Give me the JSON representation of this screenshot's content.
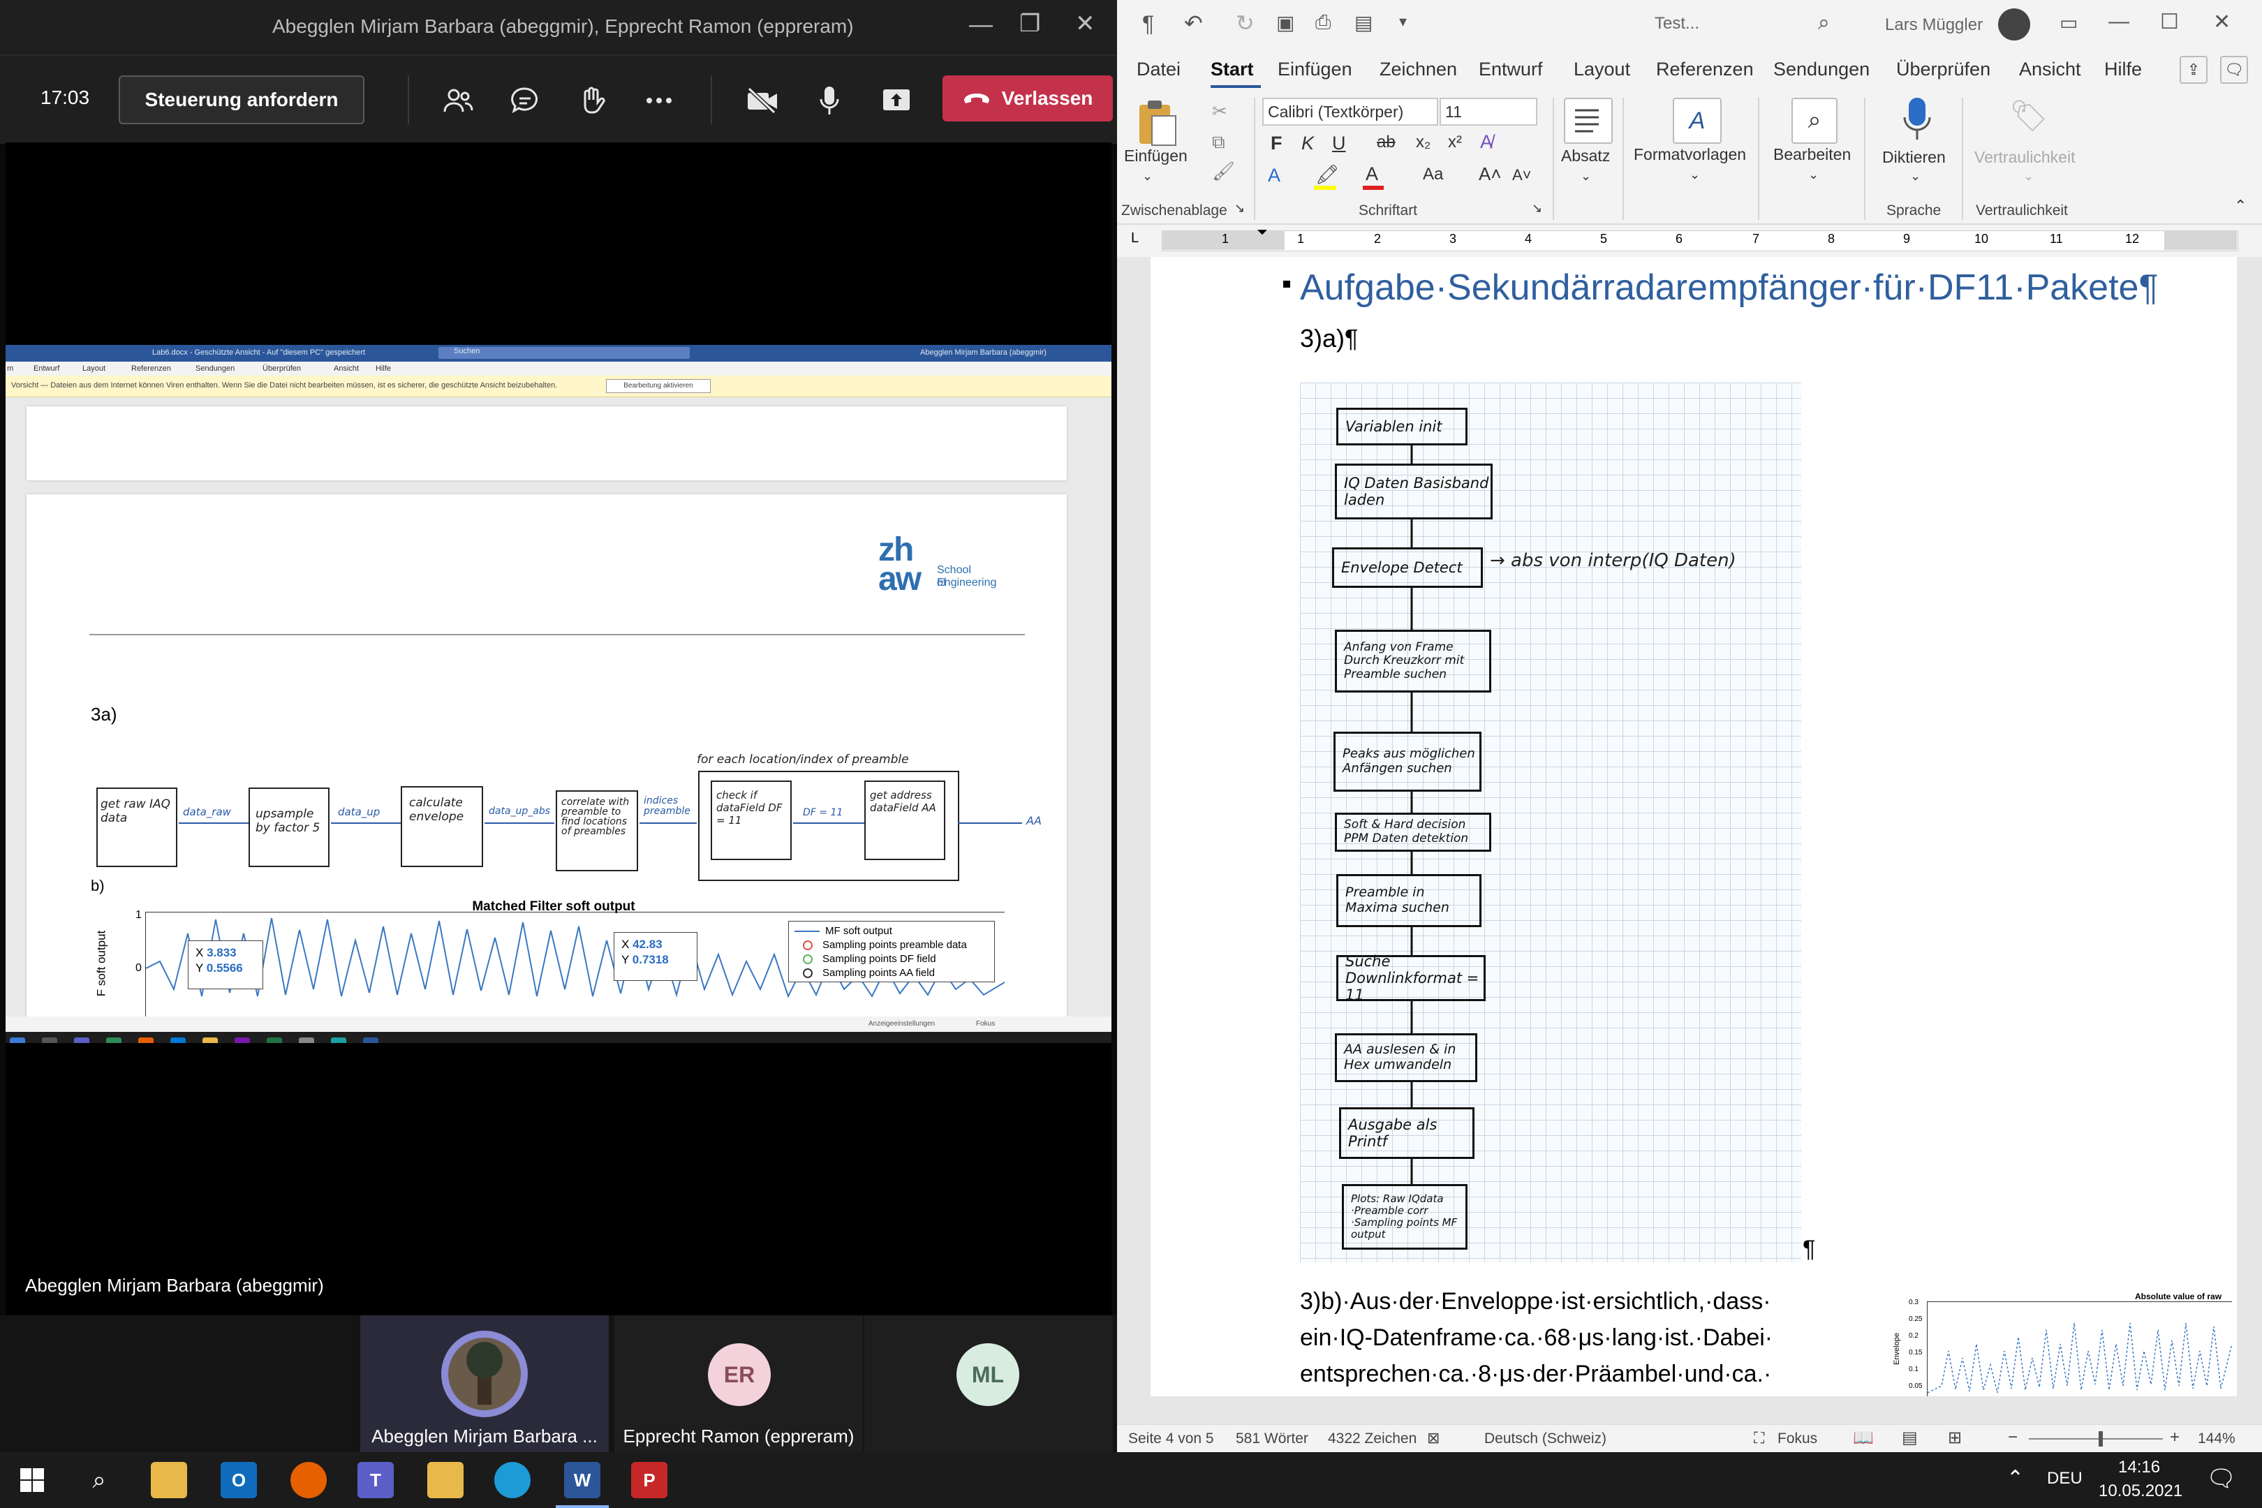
{
  "teams": {
    "window_title": "Abegglen Mirjam Barbara (abeggmir), Epprecht Ramon (eppreram)",
    "call_time": "17:03",
    "request_control": "Steuerung anfordern",
    "leave": "Verlassen",
    "shared_screen": {
      "title": "Lab6.docx - Geschützte Ansicht - Auf \"diesem PC\" gespeichert",
      "search": "Suchen",
      "user": "Abegglen Mirjam Barbara (abeggmir)",
      "tabs": [
        "m",
        "Entwurf",
        "Layout",
        "Referenzen",
        "Sendungen",
        "Überprüfen",
        "Ansicht",
        "Hilfe"
      ],
      "protected_msg": "Vorsicht — Dateien aus dem Internet können Viren enthalten. Wenn Sie die Datei nicht bearbeiten müssen, ist es sicherer, die geschützte Ansicht beizubehalten.",
      "enable_editing": "Bearbeitung aktivieren",
      "logo_zh": "zh",
      "logo_aw": "aw",
      "logo_school": "School of",
      "logo_engineering": "Engineering",
      "section_a": "3a)",
      "section_b": "b)",
      "loop_label": "for each location/index of preamble",
      "blocks": [
        "get raw IAQ data",
        "upsample by factor 5",
        "calculate envelope",
        "correlate with preamble to find locations of preambles",
        "check if dataField DF = 11",
        "get address dataField AA"
      ],
      "arrows": [
        "data_raw",
        "data_up",
        "data_up_abs",
        "indices preamble",
        "DF = 11",
        "AA"
      ],
      "chart": {
        "title": "Matched Filter soft output",
        "ylabel": "F soft output",
        "y_ticks": [
          "1",
          "0"
        ],
        "legend": [
          "MF soft output",
          "Sampling points preamble data",
          "Sampling points DF field",
          "Sampling points AA field"
        ],
        "tip1": {
          "x": "3.833",
          "y": "0.5566"
        },
        "tip2": {
          "x": "42.83",
          "y": "0.7318"
        }
      },
      "status_items": [
        "Anzeigeeinstellungen",
        "Fokus"
      ]
    },
    "presenter_label": "Abegglen Mirjam Barbara (abeggmir)",
    "participants": [
      {
        "name": "Abegglen Mirjam Barbara ...",
        "initials": ""
      },
      {
        "name": "Epprecht Ramon (eppreram)",
        "initials": "ER"
      },
      {
        "name": "",
        "initials": "ML"
      }
    ]
  },
  "word": {
    "title": "Test...",
    "user": "Lars Müggler",
    "tabs": [
      "Datei",
      "Start",
      "Einfügen",
      "Zeichnen",
      "Entwurf",
      "Layout",
      "Referenzen",
      "Sendungen",
      "Überprüfen",
      "Ansicht",
      "Hilfe"
    ],
    "active_tab": "Start",
    "ribbon": {
      "paste": "Einfügen",
      "font": "Calibri (Textkörper)",
      "size": "11",
      "paragraph": "Absatz",
      "styles": "Formatvorlagen",
      "edit": "Bearbeiten",
      "dictate": "Diktieren",
      "sensitivity": "Vertraulichkeit",
      "groups": [
        "Zwischenablage",
        "Schriftart",
        "Sprache",
        "Vertraulichkeit"
      ],
      "bold": "F",
      "italic": "K",
      "underline": "U",
      "strike": "ab",
      "sub": "x₂",
      "sup": "x²",
      "case": "Aa"
    },
    "ruler": [
      "1",
      "1",
      "2",
      "3",
      "4",
      "5",
      "6",
      "7",
      "8",
      "9",
      "10",
      "11",
      "12"
    ],
    "heading": "Aufgabe·Sekundärradarempfänger·für·DF11·Pakete¶",
    "sub_heading": "3)a)¶",
    "flowchart": [
      "Variablen init",
      "IQ Daten Basisband laden",
      "Envelope Detect",
      "Anfang von Frame Durch Kreuzkorr mit Preamble suchen",
      "Peaks aus möglichen Anfängen suchen",
      "Soft & Hard decision PPM Daten detektion",
      "Preamble in Maxima suchen",
      "Suche Downlinkformat = 11",
      "AA auslesen & in Hex umwandeln",
      "Ausgabe als Printf",
      "Plots: Raw IQdata ·Preamble corr ·Sampling points MF output"
    ],
    "flow_annotation": "→ abs von interp(IQ Daten)",
    "pilcrow": "¶",
    "para_lines": [
      "3)b)·Aus·der·Enveloppe·ist·ersichtlich,·dass·",
      "ein·IQ-Datenframe·ca.·68·μs·lang·ist.·Dabei·",
      "entsprechen·ca.·8·μs·der·Präambel·und·ca.·"
    ],
    "mini_chart_title": "Absolute value of raw",
    "mini_chart_ylabel": "Envelope",
    "mini_chart_ticks": [
      "0.3",
      "0.25",
      "0.2",
      "0.15",
      "0.1",
      "0.05"
    ],
    "status": {
      "page": "Seite 4 von 5",
      "words": "581 Wörter",
      "chars": "4322 Zeichen",
      "lang": "Deutsch (Schweiz)",
      "focus": "Fokus",
      "zoom": "144%"
    }
  },
  "taskbar": {
    "lang": "DEU",
    "time": "14:16",
    "date": "10.05.2021"
  }
}
